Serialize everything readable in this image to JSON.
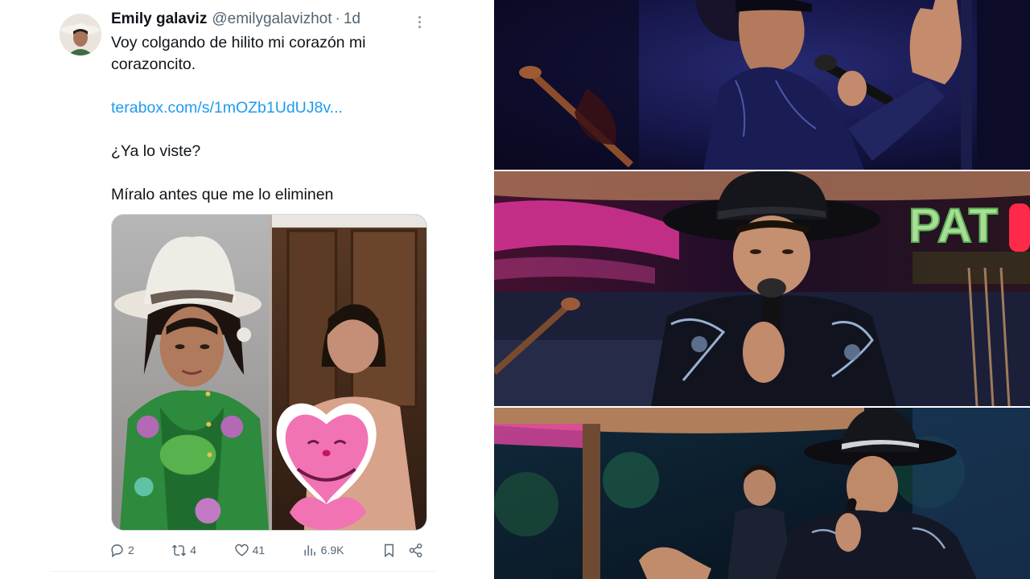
{
  "tweet": {
    "display_name": "Emily galaviz",
    "handle": "@emilygalavizhot",
    "separator": "·",
    "time": "1d",
    "text_lines": [
      "Voy colgando de hilito mi corazón mi",
      "corazoncito."
    ],
    "link": "terabox.com/s/1mOZb1UdUJ8v...",
    "question": "¿Ya lo viste?",
    "closing": "Míralo antes que me lo eliminen",
    "stats": {
      "replies": "2",
      "retweets": "4",
      "likes": "41",
      "views": "6.9K"
    }
  },
  "icons": {
    "more": "more-options-icon",
    "reply": "reply-icon",
    "retweet": "retweet-icon",
    "like": "heart-icon",
    "views": "views-chart-icon",
    "bookmark": "bookmark-icon",
    "share": "share-icon"
  },
  "colors": {
    "link": "#1d9bf0",
    "secondary_text": "#536471",
    "primary_text": "#0f1419",
    "divider": "#eff3f4"
  },
  "collage": {
    "sign_text": "PAT"
  }
}
